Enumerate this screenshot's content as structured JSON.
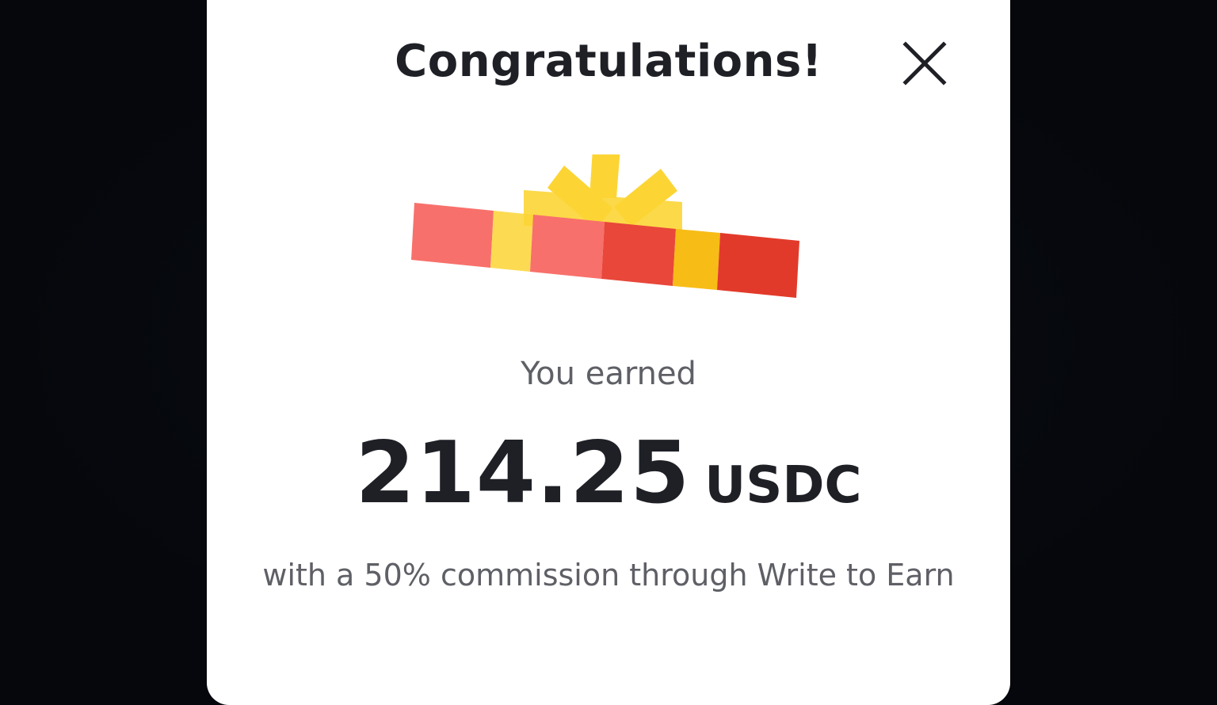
{
  "modal": {
    "title": "Congratulations!",
    "close_icon": "close-icon",
    "illustration_icon": "gift-icon",
    "earned_label": "You earned",
    "amount": "214.25",
    "currency": "USDC",
    "commission_text": "with a 50% commission through Write to Earn"
  },
  "colors": {
    "background": "#05070c",
    "card": "#ffffff",
    "text_primary": "#1e2026",
    "text_secondary": "#5e6066",
    "gift_red_light": "#f8706b",
    "gift_red": "#e8473a",
    "gift_yellow": "#fcd535",
    "gift_yellow_dark": "#f7bc16"
  }
}
